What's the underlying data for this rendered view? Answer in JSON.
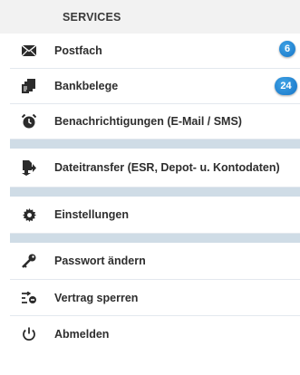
{
  "header": {
    "title": "SERVICES"
  },
  "menu": {
    "postfach": {
      "label": "Postfach",
      "badge": "6",
      "icon": "envelope-icon"
    },
    "bankbelege": {
      "label": "Bankbelege",
      "badge": "24",
      "icon": "documents-icon"
    },
    "benachrichtigungen": {
      "label": "Benachrichtigungen (E-Mail / SMS)",
      "icon": "alarm-clock-icon"
    },
    "dateitransfer": {
      "label": "Dateitransfer (ESR, Depot- u. Kontodaten)",
      "icon": "file-transfer-icon"
    },
    "einstellungen": {
      "label": "Einstellungen",
      "icon": "gear-icon"
    },
    "passwort": {
      "label": "Passwort ändern",
      "icon": "key-icon"
    },
    "vertrag": {
      "label": "Vertrag sperren",
      "icon": "lock-contract-icon"
    },
    "abmelden": {
      "label": "Abmelden",
      "icon": "power-icon"
    }
  },
  "colors": {
    "badge": "#1674c6",
    "separator": "#cfdce6",
    "header": "#f2f2f2"
  }
}
